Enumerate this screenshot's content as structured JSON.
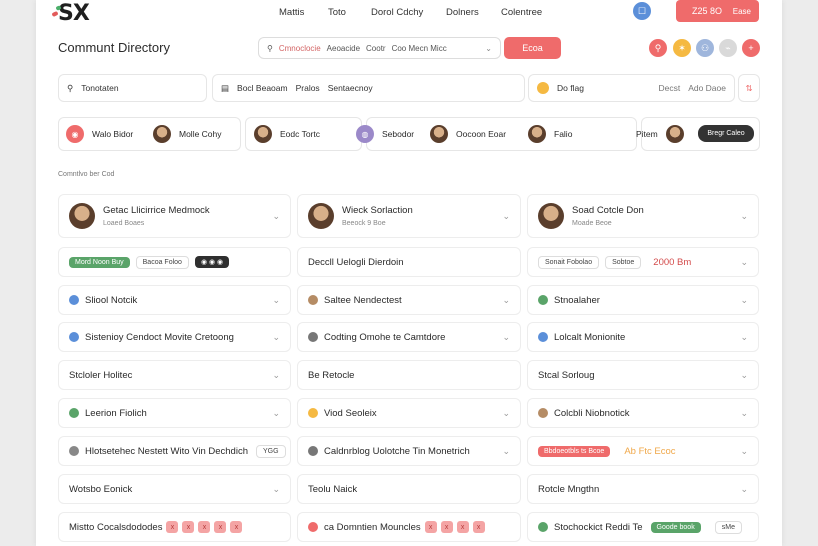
{
  "header": {
    "logo": "SX",
    "nav": [
      "Mattis",
      "Toto",
      "Dorol Cdchy",
      "Dolners",
      "Colentree"
    ],
    "user_icon": "user-icon",
    "promo": {
      "label": "Z25 8O",
      "close": "Ease"
    }
  },
  "toolbar": {
    "title": "Communt Directory",
    "search": {
      "placeholder": "Cmnoclocie",
      "chips": [
        "Aeoacide",
        "Cootr",
        "Coo Mecn Micc"
      ]
    },
    "search_button": "Ecoa",
    "circle_buttons": [
      {
        "icon": "pin-icon",
        "color": "#ef6b6b",
        "glyph": "⚲"
      },
      {
        "icon": "star-icon",
        "color": "#f5b942",
        "glyph": "✶"
      },
      {
        "icon": "people-icon",
        "color": "#9fb6dc",
        "glyph": "⚇"
      },
      {
        "icon": "link-icon",
        "color": "#d9d9d9",
        "glyph": "⌁"
      },
      {
        "icon": "plus-icon",
        "color": "#ef6b6b",
        "glyph": "+"
      }
    ]
  },
  "filters": {
    "search_value": "Tonotaten",
    "middle": [
      "Bocl Beaoam",
      "Pralos",
      "Sentaecnoy"
    ],
    "right_label": "Do flag",
    "right_muted": [
      "Decst",
      "Ado Daoe"
    ],
    "end_glyph": "⇅"
  },
  "people": [
    {
      "name": "Walo Bidor",
      "color": "#ef6b6b",
      "glyph": "◉"
    },
    {
      "name": "Molle Cohy",
      "face": true
    },
    {
      "name": "Eodc Tortc",
      "face": true
    },
    {
      "name": "Sebodor",
      "color": "#9b89c9",
      "glyph": "◍"
    },
    {
      "name": "Oocoon Eoar",
      "face": true
    },
    {
      "name": "Falio",
      "face": true
    },
    {
      "name": "Pitem",
      "face": true
    },
    {
      "name": "Bregr Caleo"
    }
  ],
  "section_label": "Comntlvo ber Cod",
  "rows": [
    {
      "type": "person",
      "title": "Getac Llicirrice Medmock",
      "sub": "Loaed Boaes"
    },
    {
      "type": "person",
      "title": "Wieck Sorlaction",
      "sub": "Beeock 9 Boe"
    },
    {
      "type": "person",
      "title": "Soad Cotcle Don",
      "sub": "Moade Beoe"
    },
    {
      "type": "tags",
      "tags": [
        {
          "label": "Mord Noon Buy",
          "style": "green"
        },
        {
          "label": "Bacoa Foloo",
          "style": "outline"
        },
        {
          "label": "◉ ◉ ◉",
          "style": "dark"
        }
      ]
    },
    {
      "type": "plain",
      "title": "Deccll Uelogli Dierdoin"
    },
    {
      "type": "tags2",
      "tags": [
        {
          "label": "Sonait Fobolao",
          "style": "outline"
        },
        {
          "label": "Sobtoe",
          "style": "outline"
        }
      ],
      "extra": "2000 Bm"
    },
    {
      "type": "icon",
      "title": "Sliool Notcik",
      "color": "#5b8fd9"
    },
    {
      "type": "icon",
      "title": "Saltee Nendectest",
      "color": "#b58c65"
    },
    {
      "type": "icon",
      "title": "Stnoalaher",
      "color": "#5aa469"
    },
    {
      "type": "icon",
      "title": "Sistenioy Cendoct Movite Cretoong",
      "color": "#5b8fd9"
    },
    {
      "type": "icon",
      "title": "Codting Omohe te Camtdore",
      "color": "#777777"
    },
    {
      "type": "icon",
      "title": "Lolcalt Monionite",
      "color": "#5b8fd9"
    },
    {
      "type": "plain-chev",
      "title": "Stcloler Holitec"
    },
    {
      "type": "plain",
      "title": "Be Retocle"
    },
    {
      "type": "plain-chev",
      "title": "Stcal Sorloug"
    },
    {
      "type": "icon",
      "title": "Leerion Fiolich",
      "color": "#5aa469"
    },
    {
      "type": "icon",
      "title": "Viod Seoleix",
      "color": "#f5b942"
    },
    {
      "type": "icon",
      "title": "Colcbli Niobnotick",
      "color": "#b58c65"
    },
    {
      "type": "icon-tag",
      "title": "Hlotsetehec Nestett Wito Vin Dechdich",
      "color": "#888888",
      "tag": "YGG"
    },
    {
      "type": "icon",
      "title": "Caldnrblog Uolotche Tin Monetrich",
      "color": "#777777"
    },
    {
      "type": "redtag",
      "tag": "Bbdoeotbls ts Bcoe",
      "extra": "Ab Ftc Ecoc"
    },
    {
      "type": "plain-chev",
      "title": "Wotsbo Eonick"
    },
    {
      "type": "plain",
      "title": "Teolu Naick"
    },
    {
      "type": "plain-chev",
      "title": "Rotcle Mngthn"
    },
    {
      "type": "xs",
      "title": "Mistto Cocalsdododes",
      "xs": [
        "x",
        "x",
        "x",
        "x",
        "x"
      ]
    },
    {
      "type": "icon-xs",
      "title": "ca Domntien Mouncles",
      "color": "#ef6b6b",
      "xs": [
        "x",
        "x",
        "x",
        "x"
      ]
    },
    {
      "type": "icon-end",
      "title": "Stochockict Reddi Te",
      "color": "#5aa469",
      "tag": "Goode book",
      "end": "sMe"
    }
  ]
}
